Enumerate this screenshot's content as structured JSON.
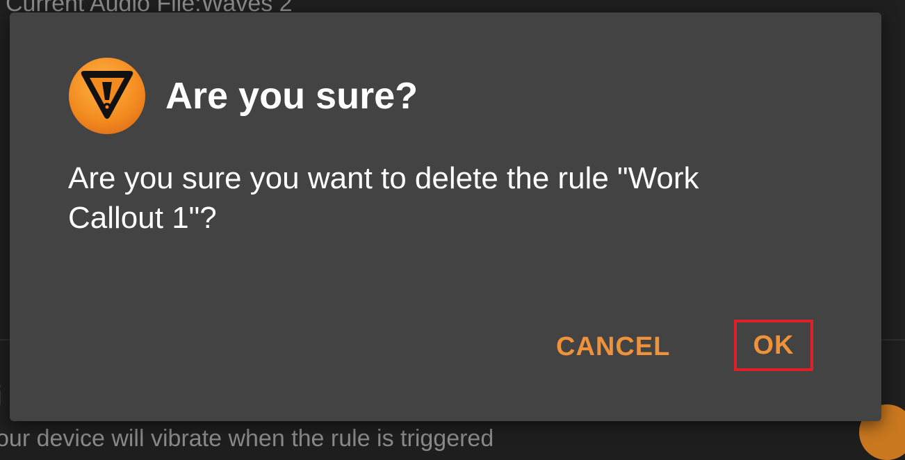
{
  "background": {
    "current_audio_text": "Current Audio File:Waves 2",
    "section_letter": "i",
    "description_text": "our device will vibrate when the rule is triggered"
  },
  "dialog": {
    "icon": "warning-triangle-icon",
    "title": "Are you sure?",
    "message": "Are you sure you want to delete the rule \"Work Callout 1\"?",
    "cancel_label": "CANCEL",
    "ok_label": "OK",
    "accent_color": "#f0923a",
    "highlight_color": "#e01f26"
  }
}
